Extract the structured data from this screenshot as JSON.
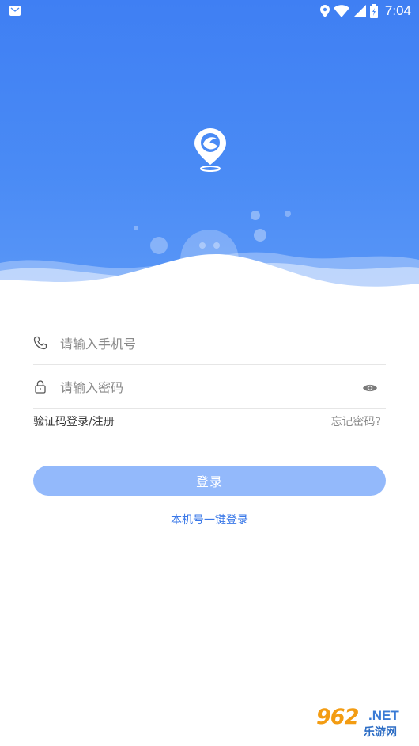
{
  "status_bar": {
    "time": "7:04",
    "icons": [
      "message-icon",
      "location-icon",
      "wifi-icon",
      "signal-icon",
      "battery-icon"
    ]
  },
  "header": {
    "logo_icon": "map-pin-logo-icon",
    "background_color": "#3f7ff3"
  },
  "form": {
    "phone": {
      "icon": "phone-icon",
      "placeholder": "请输入手机号",
      "value": ""
    },
    "password": {
      "icon": "lock-icon",
      "placeholder": "请输入密码",
      "value": "",
      "toggle_icon": "eye-icon"
    },
    "sms_login_label": "验证码登录/注册",
    "forgot_label": "忘记密码?",
    "login_button_label": "登录",
    "login_button_color": "#93b9fb",
    "one_key_login_label": "本机号一键登录",
    "link_color": "#3a78e8"
  },
  "watermark": {
    "number": "962",
    "domain": ".NET",
    "cn_text": "乐游网"
  }
}
